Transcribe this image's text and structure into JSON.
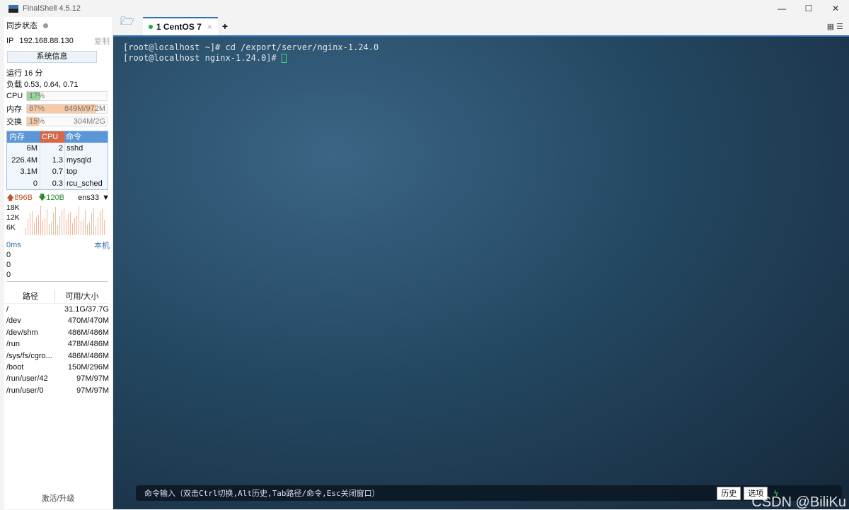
{
  "window": {
    "title": "FinalShell 4.5.12",
    "minimize": "—",
    "maximize": "☐",
    "close": "✕"
  },
  "sidebar": {
    "sync_label": "同步状态",
    "ip_label": "IP",
    "ip": "192.168.88.130",
    "copy": "复制",
    "sysinfo": "系统信息",
    "uptime": "运行 16 分",
    "load": "负载 0.53, 0.64, 0.71",
    "cpu": {
      "label": "CPU",
      "pct": "17%",
      "fraction": 0.17
    },
    "mem": {
      "label": "内存",
      "pct": "87%",
      "value": "849M/972M",
      "fraction": 0.87
    },
    "swap": {
      "label": "交换",
      "pct": "15%",
      "value": "304M/2G",
      "fraction": 0.15
    },
    "proc_headers": [
      "内存",
      "CPU",
      "命令"
    ],
    "procs": [
      [
        "6M",
        "2",
        "sshd"
      ],
      [
        "226.4M",
        "1.3",
        "mysqld"
      ],
      [
        "3.1M",
        "0.7",
        "top"
      ],
      [
        "0",
        "0.3",
        "rcu_sched"
      ]
    ],
    "net": {
      "up": "896B",
      "down": "120B",
      "iface": "ens33",
      "ticks": [
        "18K",
        "12K",
        "6K"
      ]
    },
    "ping": {
      "ms": "0ms",
      "host": "本机",
      "vals": [
        "0",
        "0",
        "0"
      ]
    },
    "disk_headers": [
      "路径",
      "可用/大小"
    ],
    "disks": [
      [
        "/",
        "31.1G/37.7G"
      ],
      [
        "/dev",
        "470M/470M"
      ],
      [
        "/dev/shm",
        "486M/486M"
      ],
      [
        "/run",
        "478M/486M"
      ],
      [
        "/sys/fs/cgro...",
        "486M/486M"
      ],
      [
        "/boot",
        "150M/296M"
      ],
      [
        "/run/user/42",
        "97M/97M"
      ],
      [
        "/run/user/0",
        "97M/97M"
      ]
    ],
    "activate": "激活/升级"
  },
  "tabs": [
    {
      "label": "1 CentOS 7",
      "close": "×"
    }
  ],
  "add_tab": "+",
  "terminal": {
    "lines": [
      "[root@localhost ~]# cd /export/server/nginx-1.24.0",
      "[root@localhost nginx-1.24.0]# "
    ]
  },
  "cmdbar": {
    "hint": "命令输入（双击Ctrl切换,Alt历史,Tab路径/命令,Esc关闭窗口）",
    "history": "历史",
    "options": "选项"
  },
  "watermark": "CSDN @BiliKu"
}
